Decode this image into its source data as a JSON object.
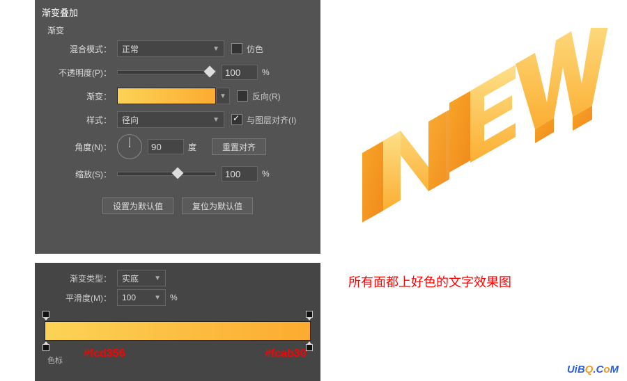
{
  "panel": {
    "title": "渐变叠加",
    "subtitle": "渐变",
    "blend_mode": {
      "label": "混合模式：",
      "value": "正常",
      "dither": "仿色"
    },
    "opacity": {
      "label": "不透明度(P)：",
      "value": "100",
      "unit": "%"
    },
    "gradient": {
      "label": "渐变：",
      "reverse": "反向(R)"
    },
    "style": {
      "label": "样式：",
      "value": "径向",
      "align": "与图层对齐(I)"
    },
    "angle": {
      "label": "角度(N)：",
      "value": "90",
      "unit": "度",
      "reset": "重置对齐"
    },
    "scale": {
      "label": "缩放(S)：",
      "value": "100",
      "unit": "%"
    },
    "set_default": "设置为默认值",
    "reset_default": "复位为默认值"
  },
  "editor": {
    "type_label": "渐变类型：",
    "type_value": "实底",
    "smooth_label": "平滑度(M)：",
    "smooth_value": "100",
    "smooth_unit": "%",
    "color_stop": "色标",
    "hex_left": "#fcd356",
    "hex_right": "#fcab30"
  },
  "caption": "所有面都上好色的文字效果图",
  "watermark": {
    "t1": "UiB",
    "t2": "Q",
    "t3": ".C",
    "t4": "o",
    "t5": "M"
  }
}
